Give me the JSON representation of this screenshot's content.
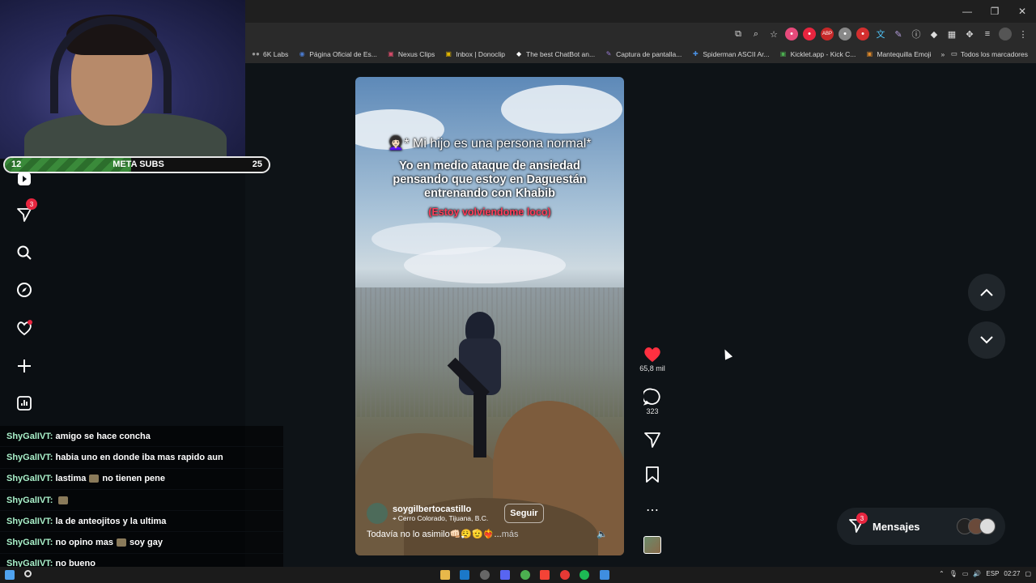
{
  "window": {
    "minimize": "—",
    "maximize": "❐",
    "close": "✕"
  },
  "bookmarks": [
    {
      "label": "6K Labs",
      "icon": "●●",
      "color": "#999999"
    },
    {
      "label": "Página Oficial de Es...",
      "icon": "◉",
      "color": "#4a7bd0"
    },
    {
      "label": "Nexus Clips",
      "icon": "▣",
      "color": "#d24b68"
    },
    {
      "label": "Inbox | Donoclip",
      "icon": "▣",
      "color": "#e0b400"
    },
    {
      "label": "The best ChatBot an...",
      "icon": "◆",
      "color": "#ffffff"
    },
    {
      "label": "Captura de pantalla...",
      "icon": "✎",
      "color": "#9b7bd8"
    },
    {
      "label": "Spiderman ASCII Ar...",
      "icon": "✚",
      "color": "#4a90e2"
    },
    {
      "label": "Kicklet.app - Kick C...",
      "icon": "▣",
      "color": "#4caf50"
    },
    {
      "label": "Mantequilla Emoji",
      "icon": "▣",
      "color": "#e08a2a"
    }
  ],
  "bookmarks_more": "»",
  "bookmarks_all": "Todos los marcadores",
  "meta_bar": {
    "left": "12",
    "title": "META SUBS",
    "right": "25",
    "progress": 0.48
  },
  "sidebar": {
    "notifications_badge": "3"
  },
  "chat": [
    {
      "user": "ShyGalIVT:",
      "msg": "amigo se hace concha",
      "emote_after": ""
    },
    {
      "user": "ShyGalIVT:",
      "msg": "habia uno en donde iba mas rapido aun",
      "emote_after": ""
    },
    {
      "user": "ShyGalIVT:",
      "msg": "lastima",
      "emote_after": "no tienen pene"
    },
    {
      "user": "ShyGalIVT:",
      "msg": "",
      "emote_after": ""
    },
    {
      "user": "ShyGalIVT:",
      "msg": "la de anteojitos y la ultima",
      "emote_after": ""
    },
    {
      "user": "ShyGalIVT:",
      "msg": "no opino mas",
      "emote_after": "soy gay"
    },
    {
      "user": "ShyGalIVT:",
      "msg": "no bueno",
      "emote_after": ""
    }
  ],
  "video": {
    "line1": "👩🏻‍🦱* Mi hijo es una persona normal*",
    "line2": "Yo en medio ataque de ansiedad pensando que estoy en Daguestán entrenando con Khabib",
    "line3": "(Estoy volviendome loco)",
    "username": "soygilbertocastillo",
    "location": "Cerro Colorado, Tijuana, B.C.",
    "follow": "Seguir",
    "caption": "Todavía no lo asimilo👊🏻😮‍💨🫡❤️‍🔥... ",
    "more": "más"
  },
  "actions": {
    "likes": "65,8 mil",
    "comments": "323"
  },
  "messages": {
    "label": "Mensajes",
    "badge": "3"
  },
  "taskbar": {
    "lang": "ESP",
    "time": "02:27"
  },
  "colors": {
    "like": "#ff3040",
    "badge": "#e8253f",
    "chat_user": "#a9f0c9",
    "subtitle_red": "#ff3d5a"
  }
}
